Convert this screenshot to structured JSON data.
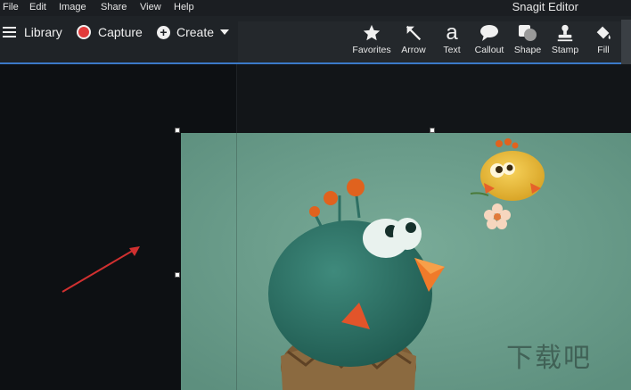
{
  "menu": {
    "file": "File",
    "edit": "Edit",
    "image": "Image",
    "share": "Share",
    "view": "View",
    "help": "Help"
  },
  "app_title": "Snagit Editor",
  "nav": {
    "library": "Library",
    "capture": "Capture",
    "create": "Create"
  },
  "tools": {
    "favorites": "Favorites",
    "arrow": "Arrow",
    "text": "Text",
    "text_glyph": "a",
    "callout": "Callout",
    "shape": "Shape",
    "stamp": "Stamp",
    "fill": "Fill"
  },
  "colors": {
    "accent": "#3b79c8",
    "record": "#e23b3b",
    "annotation_arrow": "#d03030"
  },
  "watermark": "下载吧"
}
